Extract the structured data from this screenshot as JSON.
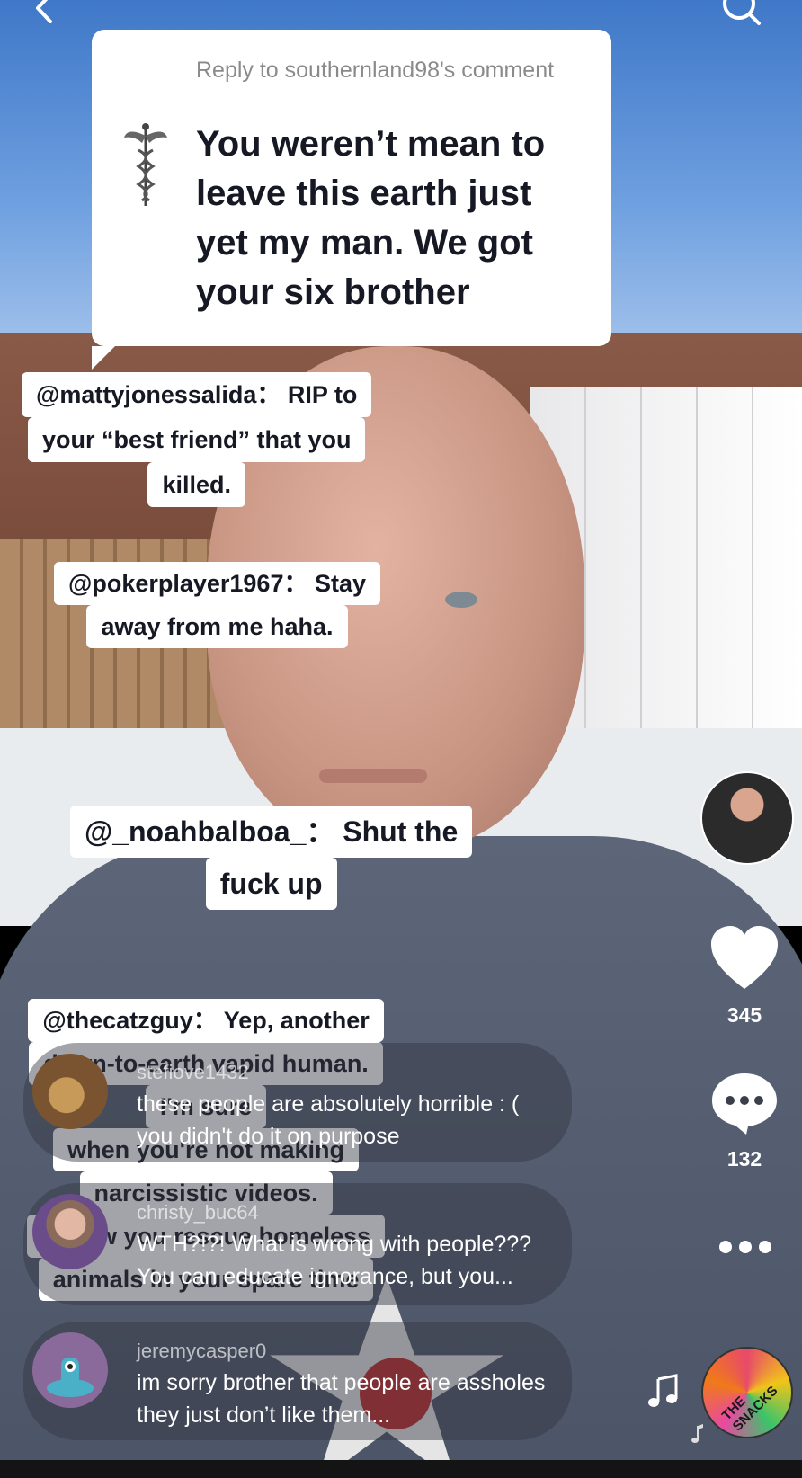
{
  "reply_card": {
    "header": "Reply to southernland98's comment",
    "text": "You weren’t mean to leave this earth just yet my man. We got your six brother",
    "icon": "caduceus-icon"
  },
  "stickers": [
    {
      "lines": [
        "@mattyjonessalida： RIP to",
        "your “best friend” that you",
        "killed."
      ]
    },
    {
      "lines": [
        "@pokerplayer1967： Stay",
        "away from me haha."
      ]
    },
    {
      "lines": [
        "@_noahbalboa_： Shut the",
        "fuck up"
      ]
    },
    {
      "lines": [
        "@thecatzguy： Yep, another",
        "down-to-earth vapid human.",
        "I'm sure",
        "when you're not making",
        "narcissistic videos.",
        "I know you rescue homeless",
        "animals in your spare time"
      ]
    }
  ],
  "comments": [
    {
      "username": "stefiove1432",
      "text": "these people are absolutely horrible : ( you didn't do it on purpose"
    },
    {
      "username": "christy_buc64",
      "text": "WTH?!?! What is wrong with people??? You can educate ignorance, but you..."
    },
    {
      "username": "jeremycasper0",
      "text": "im sorry brother that people are assholes they just don’t like them..."
    }
  ],
  "right_rail": {
    "like_count": "345",
    "comment_count": "132",
    "more_icon": "ellipsis-icon",
    "music_disc_label": "THE SNACKS"
  },
  "top_bar": {
    "back_icon": "chevron-left-icon",
    "search_icon": "search-icon"
  }
}
